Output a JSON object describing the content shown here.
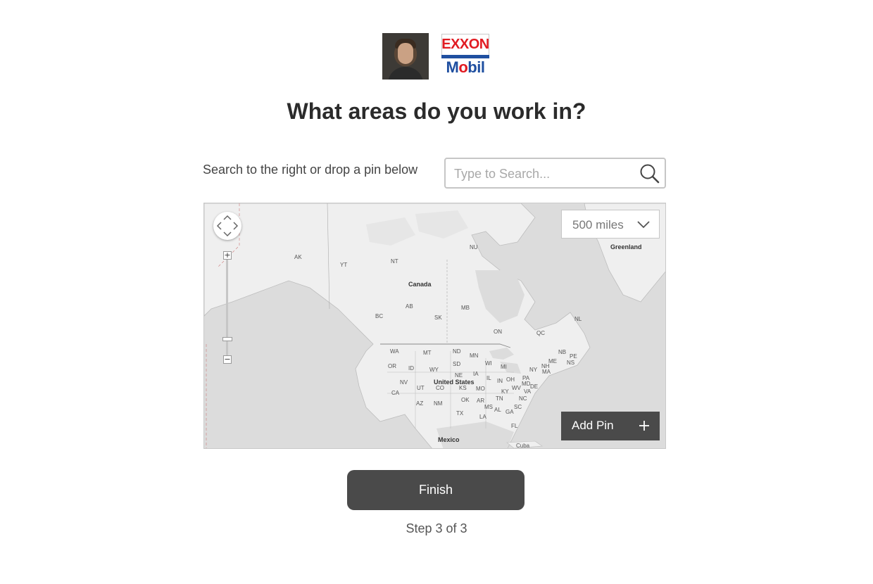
{
  "header": {
    "avatar_alt": "user photo",
    "logo_top": "EXXON",
    "logo_bottom_a": "M",
    "logo_bottom_o": "o",
    "logo_bottom_b": "bil",
    "title": "What areas do you work in?"
  },
  "search": {
    "hint": "Search to the right or drop a pin below",
    "placeholder": "Type to Search..."
  },
  "map": {
    "radius_value": "500 miles",
    "add_pin_label": "Add Pin",
    "labels": {
      "ak": "AK",
      "yt": "YT",
      "nt": "NT",
      "nu": "NU",
      "greenland": "Greenland",
      "canada": "Canada",
      "bc": "BC",
      "ab": "AB",
      "sk": "SK",
      "mb": "MB",
      "on": "ON",
      "qc": "QC",
      "nl": "NL",
      "nb": "NB",
      "pe": "PE",
      "ns": "NS",
      "wa": "WA",
      "mt": "MT",
      "nd": "ND",
      "mn": "MN",
      "or": "OR",
      "id": "ID",
      "sd": "SD",
      "wy": "WY",
      "wi": "WI",
      "mi": "MI",
      "ny": "NY",
      "me": "ME",
      "nh": "NH",
      "ma": "MA",
      "ne": "NE",
      "ia": "IA",
      "nv": "NV",
      "ut": "UT",
      "co": "CO",
      "united_states": "United States",
      "ks": "KS",
      "il": "IL",
      "in": "IN",
      "oh": "OH",
      "pa": "PA",
      "md": "MD",
      "de": "DE",
      "wv": "WV",
      "va": "VA",
      "ca": "CA",
      "mo": "MO",
      "ky": "KY",
      "nc": "NC",
      "az": "AZ",
      "nm": "NM",
      "ok": "OK",
      "ar": "AR",
      "tn": "TN",
      "sc": "SC",
      "tx": "TX",
      "ms": "MS",
      "al": "AL",
      "ga": "GA",
      "la": "LA",
      "fl": "FL",
      "mexico": "Mexico",
      "cuba": "Cuba"
    }
  },
  "footer": {
    "finish_label": "Finish",
    "step_text": "Step 3 of 3"
  },
  "colors": {
    "water": "#dcdcdc",
    "land": "#efefef",
    "button_dark": "#4a4a4a",
    "logo_red": "#e11b22",
    "logo_blue": "#1f4fa0"
  }
}
